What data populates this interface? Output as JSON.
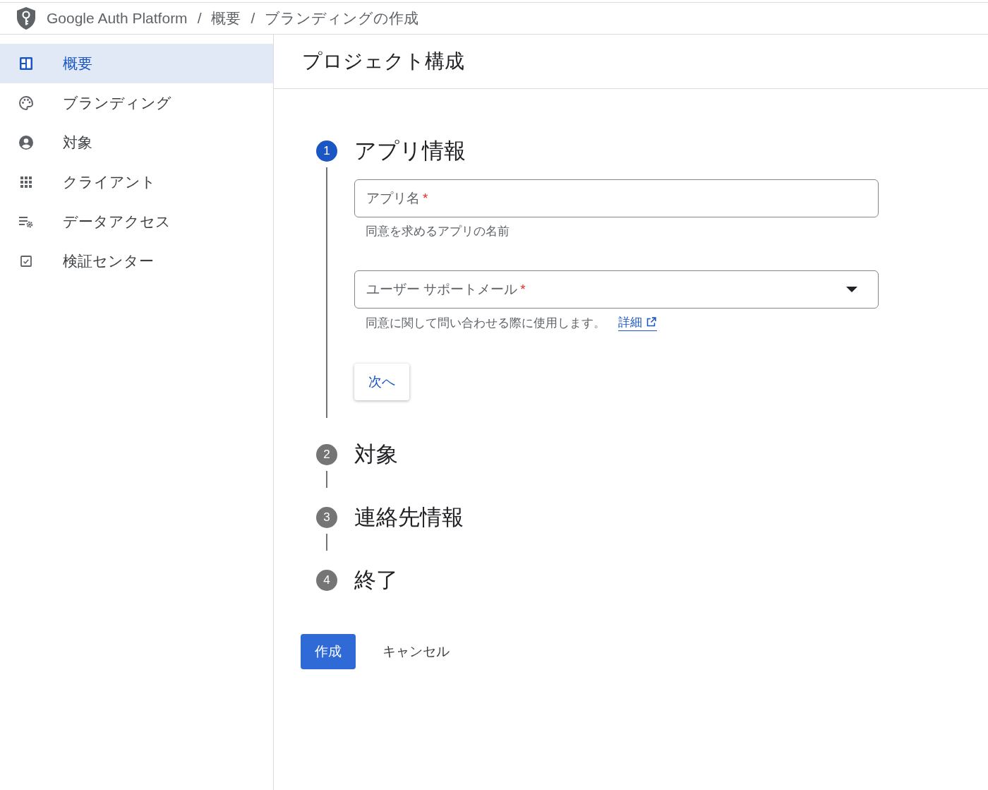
{
  "breadcrumb": {
    "product": "Google Auth Platform",
    "items": [
      {
        "label": "概要"
      },
      {
        "label": "ブランディングの作成"
      }
    ],
    "separators": [
      "/",
      "/"
    ]
  },
  "sidebar": {
    "items": [
      {
        "label": "概要",
        "kind": "dashboard",
        "selected": true
      },
      {
        "label": "ブランディング",
        "kind": "palette",
        "selected": false
      },
      {
        "label": "対象",
        "kind": "person",
        "selected": false
      },
      {
        "label": "クライアント",
        "kind": "grid",
        "selected": false
      },
      {
        "label": "データアクセス",
        "kind": "settings",
        "selected": false
      },
      {
        "label": "検証センター",
        "kind": "verification",
        "selected": false
      }
    ]
  },
  "page_title": "プロジェクト構成",
  "steps": [
    {
      "number": "1",
      "title": "アプリ情報",
      "selected": true,
      "fields": [
        {
          "kind": "text",
          "label": "アプリ名",
          "required_mark": "*",
          "helper": "同意を求めるアプリの名前"
        },
        {
          "kind": "select",
          "label": "ユーザー サポートメール",
          "required_mark": "*",
          "helper": "同意に関して問い合わせる際に使用します。",
          "link": "詳細"
        }
      ],
      "next_button": "次へ"
    },
    {
      "number": "2",
      "title": "対象",
      "selected": false
    },
    {
      "number": "3",
      "title": "連絡先情報",
      "selected": false
    },
    {
      "number": "4",
      "title": "終了",
      "selected": false
    }
  ],
  "actions": {
    "primary": "作成",
    "secondary": "キャンセル"
  }
}
